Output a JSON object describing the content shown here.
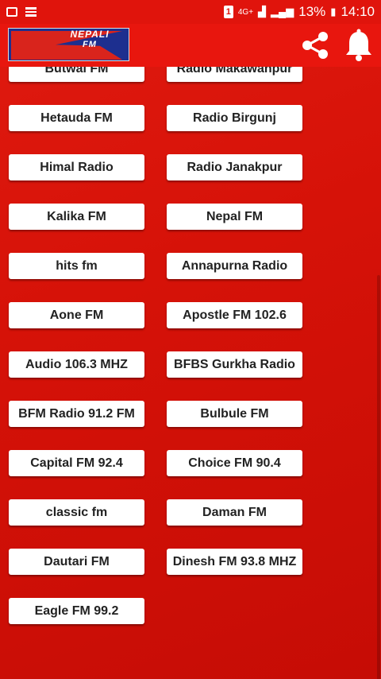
{
  "status_bar": {
    "network": "4G+",
    "battery": "13%",
    "time": "14:10",
    "sim_label": "1"
  },
  "app_bar": {
    "logo_title": "NEPALI",
    "logo_subtitle": "FM",
    "icons": [
      "share-icon",
      "bell-icon"
    ]
  },
  "colors": {
    "background": "#d61208",
    "app_bar": "#e8160e",
    "button": "#ffffff"
  },
  "stations": [
    "Butwal FM",
    "Radio Makawanpur",
    "Hetauda FM",
    "Radio Birgunj",
    "Himal Radio",
    "Radio Janakpur",
    "Kalika FM",
    "Nepal FM",
    "hits fm",
    "Annapurna Radio",
    "Aone FM",
    "Apostle FM 102.6",
    "Audio 106.3 MHZ",
    "BFBS Gurkha Radio",
    "BFM Radio 91.2 FM",
    "Bulbule FM",
    "Capital FM 92.4",
    "Choice FM 90.4",
    "classic fm",
    "Daman FM",
    "Dautari FM",
    "Dinesh FM 93.8 MHZ",
    "Eagle FM 99.2"
  ]
}
